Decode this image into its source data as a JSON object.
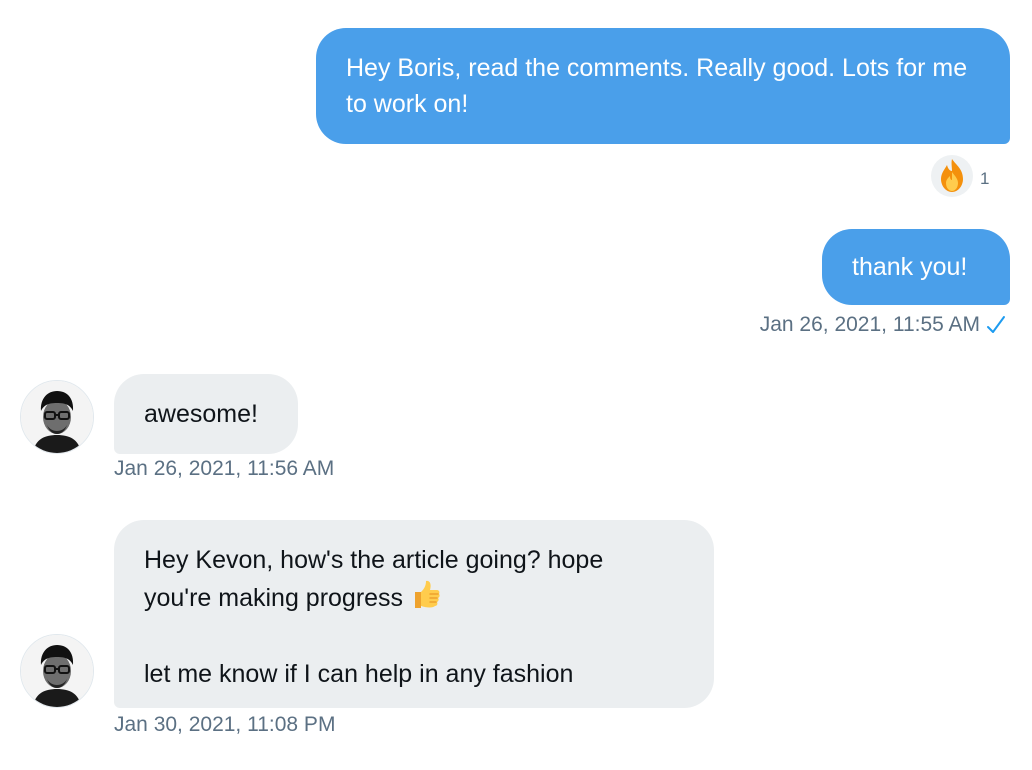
{
  "conversation": {
    "messages": [
      {
        "direction": "outgoing",
        "text": "Hey Boris, read the comments. Really good. Lots for me to work on!",
        "reaction": {
          "emoji": "fire",
          "count": "1"
        }
      },
      {
        "direction": "outgoing",
        "text": "thank you!",
        "timestamp": "Jan 26, 2021, 11:55 AM",
        "status_icon": "check-icon"
      },
      {
        "direction": "incoming",
        "text": "awesome!",
        "timestamp": "Jan 26, 2021, 11:56 AM"
      },
      {
        "direction": "incoming",
        "lines": [
          "Hey Kevon, how's the article going? hope",
          "you're making progress",
          "let me know if I can help in any fashion"
        ],
        "inline_emoji": "thumbs-up",
        "timestamp": "Jan 30, 2021, 11:08 PM"
      }
    ]
  },
  "colors": {
    "outgoing_bubble": "#4a9fea",
    "incoming_bubble": "#ebeef0",
    "timestamp_text": "#5b7083",
    "read_check": "#1d9bf0"
  }
}
